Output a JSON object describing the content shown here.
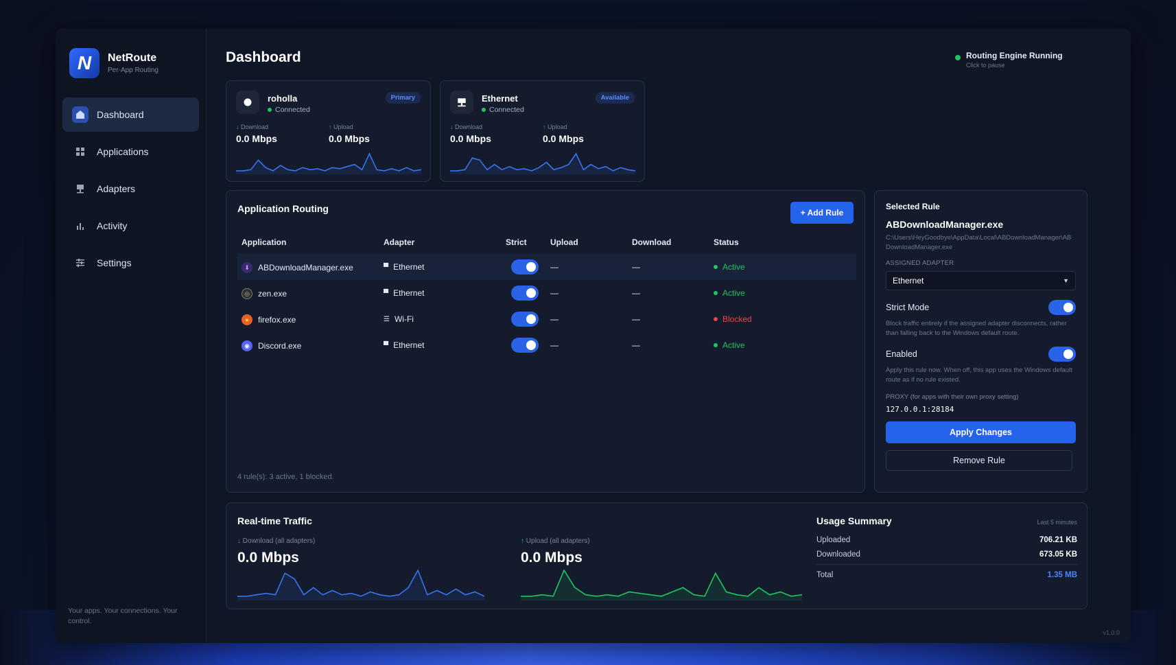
{
  "brand": {
    "name": "NetRoute",
    "tagline": "Per-App Routing",
    "logo_letter": "N"
  },
  "nav": [
    {
      "label": "Dashboard",
      "icon": "home-icon",
      "active": true
    },
    {
      "label": "Applications",
      "icon": "grid-icon",
      "active": false
    },
    {
      "label": "Adapters",
      "icon": "adapter-icon",
      "active": false
    },
    {
      "label": "Activity",
      "icon": "bar-chart-icon",
      "active": false
    },
    {
      "label": "Settings",
      "icon": "sliders-icon",
      "active": false
    }
  ],
  "sidebar_footer": "Your apps. Your connections. Your control.",
  "page_title": "Dashboard",
  "engine": {
    "title": "Routing Engine Running",
    "subtitle": "Click to pause"
  },
  "window_controls": {
    "minimize": "—",
    "close": "✕"
  },
  "adapters": [
    {
      "name": "roholla",
      "status": "Connected",
      "badge": "Primary",
      "icon": "wifi-circle-icon",
      "download_label": "Download",
      "download_value": "0.0 Mbps",
      "upload_label": "Upload",
      "upload_value": "0.0 Mbps",
      "spark": [
        2,
        2,
        3,
        12,
        5,
        2,
        7,
        3,
        2,
        5,
        3,
        4,
        2,
        5,
        4,
        6,
        8,
        3,
        18,
        3,
        2,
        4,
        2,
        5,
        2,
        3
      ]
    },
    {
      "name": "Ethernet",
      "status": "Connected",
      "badge": "Available",
      "icon": "ethernet-icon",
      "download_label": "Download",
      "download_value": "0.0 Mbps",
      "upload_label": "Upload",
      "upload_value": "0.0 Mbps",
      "spark": [
        2,
        2,
        3,
        14,
        12,
        3,
        8,
        3,
        6,
        3,
        4,
        2,
        5,
        10,
        3,
        5,
        8,
        18,
        3,
        8,
        4,
        6,
        2,
        5,
        3,
        2
      ]
    }
  ],
  "routing": {
    "title": "Application Routing",
    "add_rule_label": "+ Add Rule",
    "columns": [
      "Application",
      "Adapter",
      "Strict",
      "Upload",
      "Download",
      "Status"
    ],
    "rows": [
      {
        "app": "ABDownloadManager.exe",
        "app_icon": "download-manager-icon",
        "adapter": "Ethernet",
        "adapter_icon": "ethernet-icon",
        "strict": true,
        "upload": "—",
        "download": "—",
        "status": "Active",
        "status_color": "#22c55e",
        "selected": true
      },
      {
        "app": "zen.exe",
        "app_icon": "zen-icon",
        "adapter": "Ethernet",
        "adapter_icon": "ethernet-icon",
        "strict": true,
        "upload": "—",
        "download": "—",
        "status": "Active",
        "status_color": "#22c55e",
        "selected": false
      },
      {
        "app": "firefox.exe",
        "app_icon": "firefox-icon",
        "adapter": "Wi-Fi",
        "adapter_icon": "wifi-icon",
        "strict": true,
        "upload": "—",
        "download": "—",
        "status": "Blocked",
        "status_color": "#ef4444",
        "selected": false
      },
      {
        "app": "Discord.exe",
        "app_icon": "discord-icon",
        "adapter": "Ethernet",
        "adapter_icon": "ethernet-icon",
        "strict": true,
        "upload": "—",
        "download": "—",
        "status": "Active",
        "status_color": "#22c55e",
        "selected": false
      }
    ],
    "footnote": "4 rule(s): 3 active, 1 blocked."
  },
  "selected_rule": {
    "heading": "Selected Rule",
    "app": "ABDownloadManager.exe",
    "path": "C:\\Users\\HeyGoodbye\\AppData\\Local\\ABDownloadManager\\ABDownloadManager.exe",
    "assigned_label": "ASSIGNED ADAPTER",
    "assigned_value": "Ethernet",
    "strict_title": "Strict Mode",
    "strict_on": true,
    "strict_desc": "Block traffic entirely if the assigned adapter disconnects, rather than falling back to the Windows default route.",
    "enabled_title": "Enabled",
    "enabled_on": true,
    "enabled_desc": "Apply this rule now. When off, this app uses the Windows default route as if no rule existed.",
    "proxy_label": "PROXY (for apps with their own proxy setting)",
    "proxy_value": "127.0.0.1:28184",
    "apply_label": "Apply Changes",
    "remove_label": "Remove Rule"
  },
  "traffic": {
    "title": "Real-time Traffic",
    "download_label": "Download (all adapters)",
    "download_value": "0.0 Mbps",
    "upload_label": "Upload (all adapters)",
    "upload_value": "0.0 Mbps",
    "download_spark": [
      2,
      2,
      3,
      4,
      3,
      18,
      14,
      3,
      8,
      3,
      6,
      3,
      4,
      2,
      5,
      3,
      2,
      3,
      8,
      20,
      3,
      6,
      3,
      7,
      3,
      5,
      2
    ],
    "upload_spark": [
      2,
      2,
      3,
      2,
      20,
      8,
      3,
      2,
      3,
      2,
      5,
      4,
      3,
      2,
      5,
      8,
      3,
      2,
      18,
      5,
      3,
      2,
      8,
      3,
      5,
      2,
      3
    ]
  },
  "usage": {
    "title": "Usage Summary",
    "window": "Last 5 minutes",
    "uploaded_label": "Uploaded",
    "uploaded_value": "706.21 KB",
    "downloaded_label": "Downloaded",
    "downloaded_value": "673.05 KB",
    "total_label": "Total",
    "total_value": "1.35 MB",
    "total_color": "#4f82ff"
  },
  "version": "v1.0.0"
}
